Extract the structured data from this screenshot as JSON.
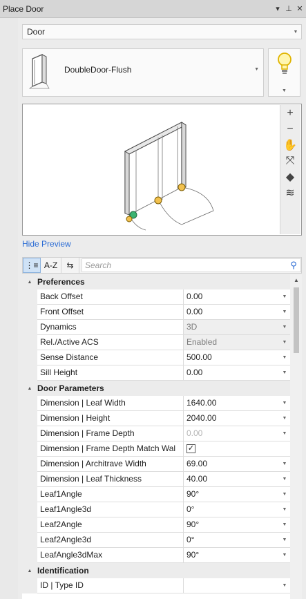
{
  "window": {
    "title": "Place Door",
    "controls": [
      "▾",
      "⊥",
      "✕"
    ]
  },
  "element_type": {
    "value": "Door"
  },
  "tool": {
    "name": "DoubleDoor-Flush",
    "thumbnail_icon": "door-thumbnail-icon",
    "bulb_icon": "lightbulb-icon"
  },
  "preview": {
    "tools": [
      {
        "icon": "zoom-in-icon",
        "glyph": "+"
      },
      {
        "icon": "zoom-out-icon",
        "glyph": "−"
      },
      {
        "icon": "pan-hand-icon",
        "glyph": "✋"
      },
      {
        "icon": "fit-view-icon",
        "glyph": "⤧"
      },
      {
        "icon": "view-3d-icon",
        "glyph": "◆"
      },
      {
        "icon": "render-mode-icon",
        "glyph": "≋"
      }
    ],
    "hide_label": "Hide Preview"
  },
  "toolbar": {
    "categorized_label": "⋮≡",
    "az_label": "A-Z",
    "third_label": "⇆",
    "search_placeholder": "Search"
  },
  "categories": [
    {
      "label": "Preferences",
      "rows": [
        {
          "name": "Back Offset",
          "value": "0.00",
          "state": "dropdown"
        },
        {
          "name": "Front Offset",
          "value": "0.00",
          "state": "dropdown"
        },
        {
          "name": "Dynamics",
          "value": "3D",
          "state": "disabled-dropdown"
        },
        {
          "name": "Rel./Active ACS",
          "value": "Enabled",
          "state": "disabled-dropdown"
        },
        {
          "name": "Sense Distance",
          "value": "500.00",
          "state": "dropdown"
        },
        {
          "name": "Sill Height",
          "value": "0.00",
          "state": "dropdown"
        }
      ]
    },
    {
      "label": "Door Parameters",
      "rows": [
        {
          "name": "Dimension | Leaf Width",
          "value": "1640.00",
          "state": "dropdown"
        },
        {
          "name": "Dimension | Height",
          "value": "2040.00",
          "state": "dropdown"
        },
        {
          "name": "Dimension | Frame Depth",
          "value": "0.00",
          "state": "dim-dropdown"
        },
        {
          "name": "Dimension | Frame Depth Match Wal",
          "value": "✓",
          "state": "checkbox"
        },
        {
          "name": "Dimension | Architrave Width",
          "value": "69.00",
          "state": "dropdown"
        },
        {
          "name": "Dimension | Leaf Thickness",
          "value": "40.00",
          "state": "dropdown"
        },
        {
          "name": "Leaf1Angle",
          "value": "90°",
          "state": "dropdown"
        },
        {
          "name": "Leaf1Angle3d",
          "value": "0°",
          "state": "dropdown"
        },
        {
          "name": "Leaf2Angle",
          "value": "90°",
          "state": "dropdown"
        },
        {
          "name": "Leaf2Angle3d",
          "value": "0°",
          "state": "dropdown"
        },
        {
          "name": "LeafAngle3dMax",
          "value": "90°",
          "state": "dropdown"
        }
      ]
    },
    {
      "label": "Identification",
      "rows": [
        {
          "name": "ID | Type ID",
          "value": "",
          "state": "dropdown"
        }
      ]
    }
  ]
}
